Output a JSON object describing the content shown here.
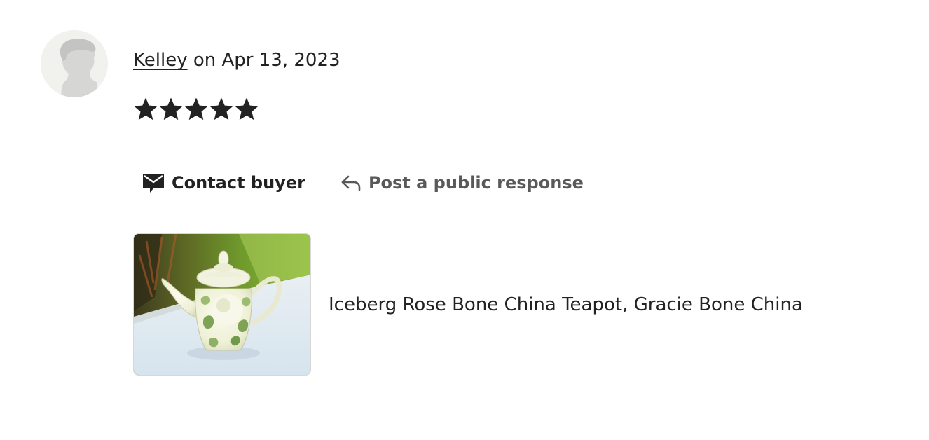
{
  "review": {
    "reviewer_name": "Kelley",
    "date_text": " on Apr 13, 2023",
    "rating": 5,
    "rating_max": 5
  },
  "actions": {
    "contact_label": "Contact buyer",
    "respond_label": "Post a public response"
  },
  "listing": {
    "title": "Iceberg Rose Bone China Teapot, Gracie Bone China",
    "thumbnail_icon": "teapot-photo"
  },
  "colors": {
    "text": "#222222",
    "muted_action": "#595959",
    "avatar_bg": "#f1f1ee",
    "avatar_silhouette": "#d5d5d3"
  }
}
